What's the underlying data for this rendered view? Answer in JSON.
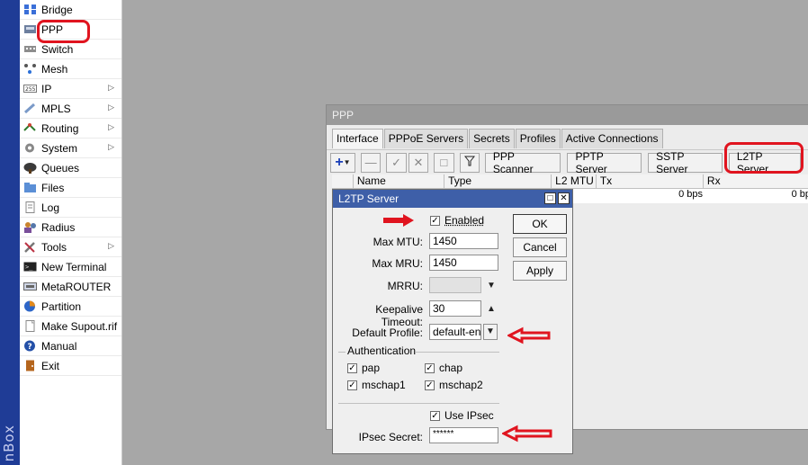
{
  "brand": "nBox",
  "sidebar": {
    "items": [
      {
        "label": "Bridge",
        "icon": "bridge-icon",
        "submenu": false
      },
      {
        "label": "PPP",
        "icon": "ppp-icon",
        "submenu": false
      },
      {
        "label": "Switch",
        "icon": "switch-icon",
        "submenu": false
      },
      {
        "label": "Mesh",
        "icon": "mesh-icon",
        "submenu": false
      },
      {
        "label": "IP",
        "icon": "ip-icon",
        "submenu": true
      },
      {
        "label": "MPLS",
        "icon": "mpls-icon",
        "submenu": true
      },
      {
        "label": "Routing",
        "icon": "routing-icon",
        "submenu": true
      },
      {
        "label": "System",
        "icon": "system-icon",
        "submenu": true
      },
      {
        "label": "Queues",
        "icon": "queues-icon",
        "submenu": false
      },
      {
        "label": "Files",
        "icon": "files-icon",
        "submenu": false
      },
      {
        "label": "Log",
        "icon": "log-icon",
        "submenu": false
      },
      {
        "label": "Radius",
        "icon": "radius-icon",
        "submenu": false
      },
      {
        "label": "Tools",
        "icon": "tools-icon",
        "submenu": true
      },
      {
        "label": "New Terminal",
        "icon": "terminal-icon",
        "submenu": false
      },
      {
        "label": "MetaROUTER",
        "icon": "metarouter-icon",
        "submenu": false
      },
      {
        "label": "Partition",
        "icon": "partition-icon",
        "submenu": false
      },
      {
        "label": "Make Supout.rif",
        "icon": "supout-icon",
        "submenu": false
      },
      {
        "label": "Manual",
        "icon": "manual-icon",
        "submenu": false
      },
      {
        "label": "Exit",
        "icon": "exit-icon",
        "submenu": false
      }
    ]
  },
  "ppp_window": {
    "title": "PPP",
    "tabs": [
      "Interface",
      "PPPoE Servers",
      "Secrets",
      "Profiles",
      "Active Connections"
    ],
    "active_tab": "Interface",
    "toolbar_buttons": [
      "PPP Scanner",
      "PPTP Server",
      "SSTP Server",
      "L2TP Server"
    ],
    "columns": [
      "Name",
      "Type",
      "L2 MTU",
      "Tx",
      "Rx"
    ],
    "row": {
      "tx": "0 bps",
      "rx": "0 bp"
    }
  },
  "dialog": {
    "title": "L2TP Server",
    "enabled_label": "Enabled",
    "enabled": true,
    "max_mtu_label": "Max MTU:",
    "max_mtu": "1450",
    "max_mru_label": "Max MRU:",
    "max_mru": "1450",
    "mrru_label": "MRRU:",
    "mrru": "",
    "keepalive_label": "Keepalive Timeout:",
    "keepalive": "30",
    "profile_label": "Default Profile:",
    "profile": "default-encı",
    "auth_title": "Authentication",
    "auth": [
      {
        "label": "pap",
        "checked": true
      },
      {
        "label": "chap",
        "checked": true
      },
      {
        "label": "mschap1",
        "checked": true
      },
      {
        "label": "mschap2",
        "checked": true
      }
    ],
    "use_ipsec_label": "Use IPsec",
    "use_ipsec": true,
    "ipsec_secret_label": "IPsec Secret:",
    "ipsec_secret": "******",
    "ok_label": "OK",
    "cancel_label": "Cancel",
    "apply_label": "Apply"
  },
  "annotation_color": "#e0141f"
}
